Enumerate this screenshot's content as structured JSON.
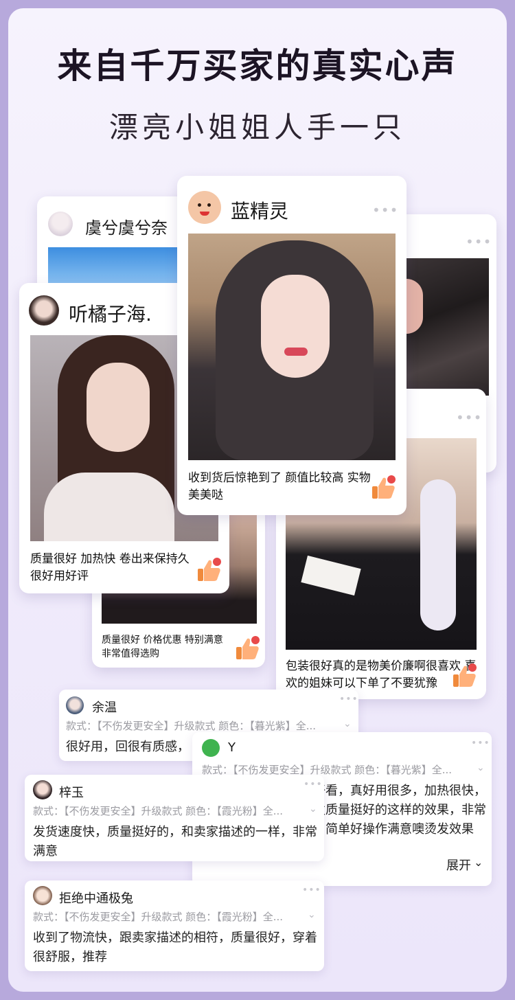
{
  "header": {
    "title": "来自千万买家的真实心声",
    "subtitle": "漂亮小姐姐人手一只"
  },
  "cards": [
    {
      "user": "虞兮虞兮奈",
      "caption": ""
    },
    {
      "user": "",
      "caption": ""
    },
    {
      "user": "听橘子海.",
      "caption": "质量很好 加热快 卷出来保持久 很好用好评"
    },
    {
      "user": "",
      "caption": "质量很好 价格优惠 特别满意 非常值得选购"
    },
    {
      "user": "",
      "caption": "包装很好真的是物美价廉啊很喜欢 喜欢的姐妹可以下单了不要犹豫"
    },
    {
      "user": "蓝精灵",
      "caption": "收到货后惊艳到了 颜值比较高 实物美美哒"
    }
  ],
  "more_glyph": "•••",
  "reviews": [
    {
      "user": "余温",
      "spec": "款式：【不伤发更安全】升级款式 颜色：【暮光紫】全...",
      "text": "很好用，回很有质感，"
    },
    {
      "user": "Y",
      "spec": "款式：【不伤发更安全】升级款式 颜色：【暮光紫】全...",
      "text": "是我喜欢的。卷的超好看，真好用很多，加热很快，使用时很自然不伤头发质量挺好的这样的效果，非常开心，夹出来很漂亮，简单好操作满意噢烫发效果好，方便",
      "expand": "展开"
    },
    {
      "user": "梓玉",
      "spec": "款式：【不伤发更安全】升级款式 颜色：【霞光粉】全...",
      "text": "发货速度快，质量挺好的，和卖家描述的一样，非常满意"
    },
    {
      "user": "拒绝中通极兔",
      "spec": "款式：【不伤发更安全】升级款式 颜色：【霞光粉】全...",
      "text": "收到了物流快，跟卖家描述的相符，质量很好，穿着很舒服，推荐"
    }
  ]
}
